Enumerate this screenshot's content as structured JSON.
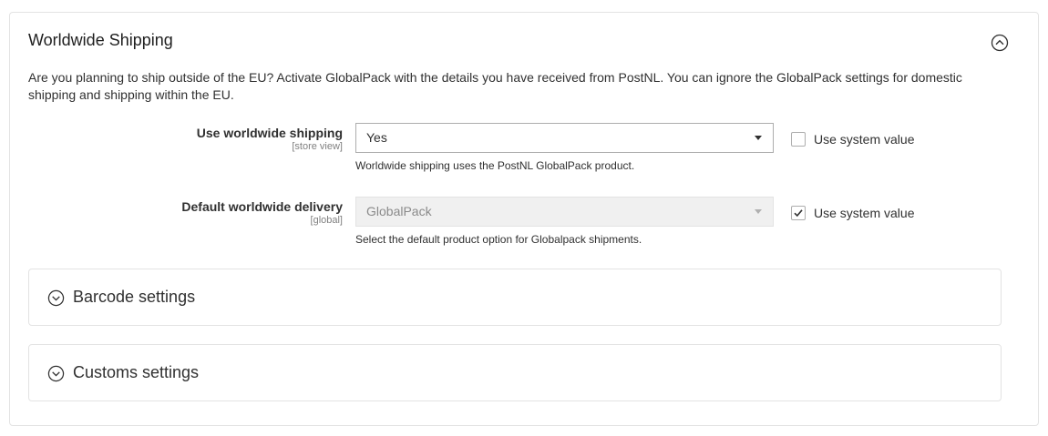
{
  "panel": {
    "title": "Worldwide Shipping",
    "collapse_icon": "chevron-up-circle-icon",
    "intro": "Are you planning to ship outside of the EU? Activate GlobalPack with the details you have received from PostNL. You can ignore the GlobalPack settings for domestic shipping and shipping within the EU."
  },
  "fields": [
    {
      "label": "Use worldwide shipping",
      "scope": "[store view]",
      "value": "Yes",
      "disabled": false,
      "note": "Worldwide shipping uses the PostNL GlobalPack product.",
      "use_system_label": "Use system value",
      "use_system_checked": false
    },
    {
      "label": "Default worldwide delivery",
      "scope": "[global]",
      "value": "GlobalPack",
      "disabled": true,
      "note": "Select the default product option for Globalpack shipments.",
      "use_system_label": "Use system value",
      "use_system_checked": true
    }
  ],
  "subsections": [
    {
      "title": "Barcode settings",
      "icon": "chevron-down-circle-icon"
    },
    {
      "title": "Customs settings",
      "icon": "chevron-down-circle-icon"
    }
  ],
  "colors": {
    "border": "#e3e3e3",
    "text": "#303030",
    "disabled_bg": "#f0f0f0"
  }
}
